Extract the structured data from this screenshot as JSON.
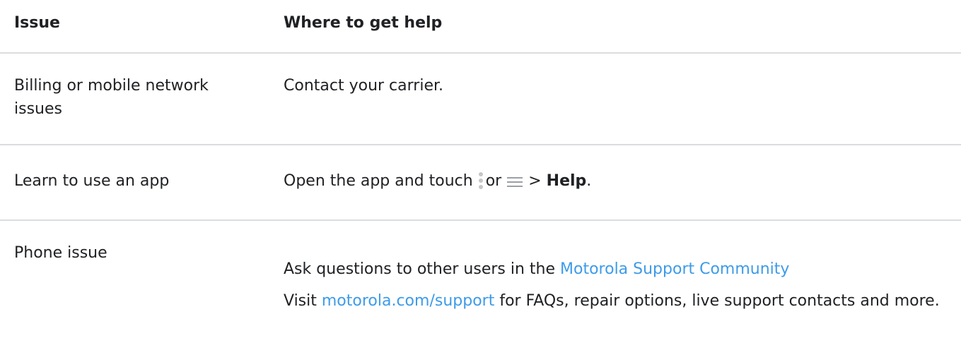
{
  "table": {
    "headers": {
      "issue": "Issue",
      "help": "Where to get help"
    },
    "rows": [
      {
        "issue": "Billing or mobile network issues",
        "help": "Contact your carrier."
      },
      {
        "issue": "Learn to use an app",
        "help_prefix": "Open the app and touch",
        "help_or": "or",
        "help_sep": ">",
        "help_bold": "Help",
        "help_end": ".",
        "icons": [
          "more-vertical-icon",
          "menu-icon"
        ]
      },
      {
        "issue": "Phone issue",
        "line1_prefix": "Ask questions to other users in the ",
        "line1_link": "Motorola Support Community",
        "line2_link": "motorola.com/support",
        "line2_suffix": " for FAQs, repair options, live support contacts and more.",
        "line2_prefix": "Visit "
      }
    ]
  },
  "colors": {
    "link": "#3d9be9",
    "divider": "#dadce0",
    "text": "#202124"
  }
}
